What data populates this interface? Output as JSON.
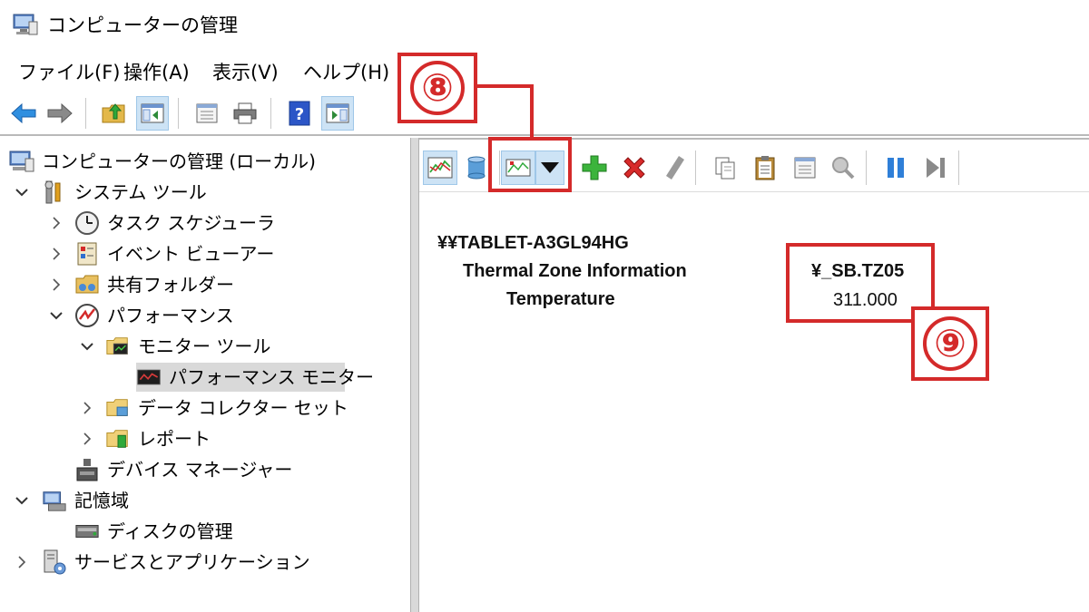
{
  "window": {
    "title": "コンピューターの管理"
  },
  "menu": [
    "ファイル(F)",
    "操作(A)",
    "表示(V)",
    "ヘルプ(H)"
  ],
  "tree": [
    {
      "label": "コンピューターの管理 (ローカル)",
      "icon": "computer-management-icon"
    },
    {
      "label": "システム ツール",
      "icon": "system-tools-icon"
    },
    {
      "label": "タスク スケジューラ",
      "icon": "clock-icon"
    },
    {
      "label": "イベント ビューアー",
      "icon": "event-viewer-icon"
    },
    {
      "label": "共有フォルダー",
      "icon": "shared-folder-icon"
    },
    {
      "label": "パフォーマンス",
      "icon": "performance-icon"
    },
    {
      "label": "モニター ツール",
      "icon": "folder-icon"
    },
    {
      "label": "パフォーマンス モニター",
      "icon": "performance-monitor-icon"
    },
    {
      "label": "データ コレクター セット",
      "icon": "folder-icon"
    },
    {
      "label": "レポート",
      "icon": "folder-report-icon"
    },
    {
      "label": "デバイス マネージャー",
      "icon": "device-manager-icon"
    },
    {
      "label": "記憶域",
      "icon": "storage-icon"
    },
    {
      "label": "ディスクの管理",
      "icon": "disk-icon"
    },
    {
      "label": "サービスとアプリケーション",
      "icon": "services-icon"
    }
  ],
  "report": {
    "machine": "¥¥TABLET-A3GL94HG",
    "object": "Thermal Zone Information",
    "counter": "Temperature",
    "instance": "¥_SB.TZ05",
    "value": "311.000"
  },
  "callouts": {
    "c8": "⑧",
    "c9": "⑨"
  },
  "colors": {
    "callout": "#d42a2a",
    "selection": "#d9d9d9",
    "pressed": "#cde3f5"
  }
}
